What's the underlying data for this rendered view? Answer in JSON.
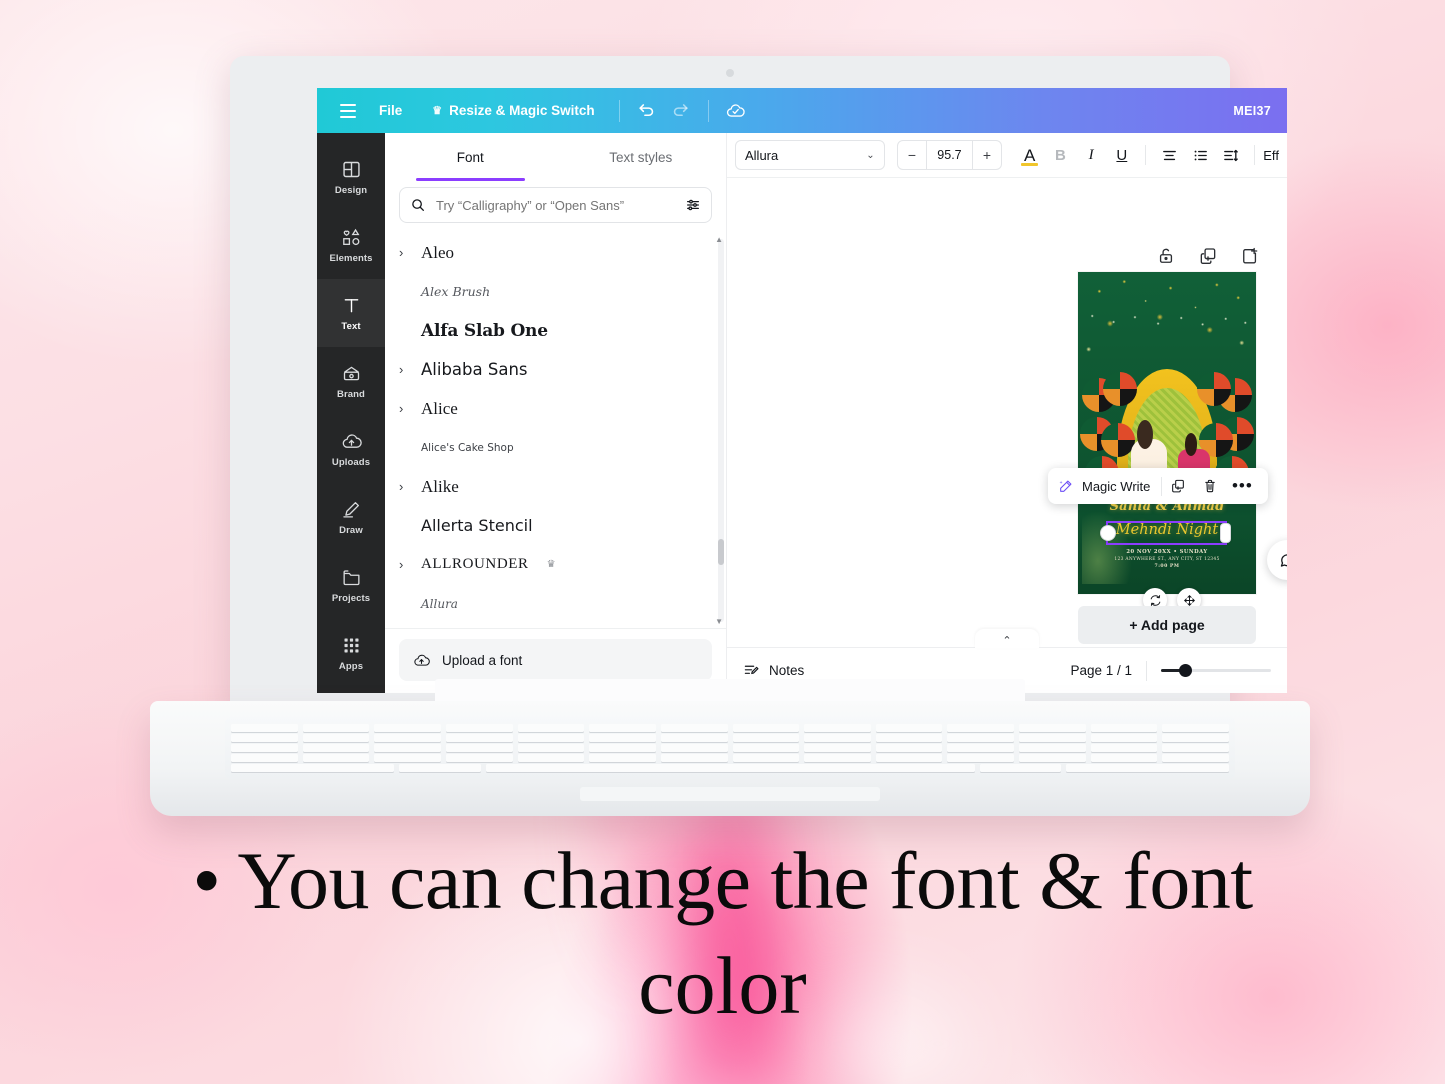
{
  "app": {
    "topbar": {
      "menu_icon": "hamburger-icon",
      "file_label": "File",
      "resize_label": "Resize & Magic Switch",
      "crown_glyph": "♛",
      "undo_icon": "undo-icon",
      "redo_icon": "redo-icon",
      "cloud_icon": "cloud-saved-icon",
      "user_badge": "MEI37",
      "gradient_from": "#20c9d6",
      "gradient_to": "#7b6ff0"
    },
    "sidebar": {
      "items": [
        {
          "label": "Design",
          "icon": "design-icon",
          "active": false
        },
        {
          "label": "Elements",
          "icon": "elements-icon",
          "active": false
        },
        {
          "label": "Text",
          "icon": "text-icon",
          "active": true
        },
        {
          "label": "Brand",
          "icon": "brand-icon",
          "active": false
        },
        {
          "label": "Uploads",
          "icon": "uploads-icon",
          "active": false
        },
        {
          "label": "Draw",
          "icon": "draw-icon",
          "active": false
        },
        {
          "label": "Projects",
          "icon": "projects-icon",
          "active": false
        },
        {
          "label": "Apps",
          "icon": "apps-icon",
          "active": false
        }
      ]
    },
    "panel": {
      "tabs": [
        {
          "label": "Font",
          "active": true
        },
        {
          "label": "Text styles",
          "active": false
        }
      ],
      "search": {
        "placeholder": "Try “Calligraphy” or “Open Sans”",
        "value": "",
        "icon": "search-icon",
        "filter_icon": "filter-icon"
      },
      "fonts": [
        {
          "name": "Aleo",
          "expandable": true,
          "pro": false,
          "style": "f-aleo"
        },
        {
          "name": "Alex Brush",
          "expandable": false,
          "pro": false,
          "style": "f-alexbrush"
        },
        {
          "name": "Alfa Slab One",
          "expandable": false,
          "pro": false,
          "style": "f-alfaslab"
        },
        {
          "name": "Alibaba Sans",
          "expandable": true,
          "pro": false,
          "style": "f-alibaba"
        },
        {
          "name": "Alice",
          "expandable": true,
          "pro": false,
          "style": "f-alice"
        },
        {
          "name": "Alice's Cake Shop",
          "expandable": false,
          "pro": false,
          "style": "f-cakeshop"
        },
        {
          "name": "Alike",
          "expandable": true,
          "pro": false,
          "style": "f-alike"
        },
        {
          "name": "Allerta Stencil",
          "expandable": false,
          "pro": false,
          "style": "f-allerta"
        },
        {
          "name": "ALLROUNDER",
          "expandable": true,
          "pro": true,
          "style": "f-allrounder"
        },
        {
          "name": "Allura",
          "expandable": false,
          "pro": false,
          "style": "f-allura"
        }
      ],
      "upload_label": "Upload a font",
      "upload_icon": "upload-cloud-icon",
      "crown_glyph": "♛",
      "scroll_up_glyph": "▲",
      "scroll_down_glyph": "▼"
    },
    "toolbar": {
      "font_family": "Allura",
      "font_size": "95.7",
      "minus_label": "−",
      "plus_label": "+",
      "text_color_icon": "text-color-icon",
      "text_color_swatch": "#f1c62c",
      "bold_label": "B",
      "italic_label": "I",
      "underline_label": "U",
      "align_icon": "align-center-icon",
      "list_icon": "bullet-list-icon",
      "spacing_icon": "line-spacing-icon",
      "effects_label": "Eff",
      "dropdown_glyph": "⌄"
    },
    "canvas": {
      "doc_icons": [
        {
          "name": "lock-icon"
        },
        {
          "name": "duplicate-page-icon"
        },
        {
          "name": "add-page-icon"
        }
      ],
      "design": {
        "title_line1": "Sania & Ahmad",
        "title_line2": "Mehndi Night",
        "date_line": "20 NOV 20XX • SUNDAY",
        "address_line": "123 ANYWHERE ST., ANY CITY, ST 12345",
        "time_line": "7:00 PM",
        "background_color": "#0f5b33",
        "accent_color": "#f3d24a",
        "selection_color": "#8b3dff"
      },
      "float_toolbar": {
        "magic_write_label": "Magic Write",
        "magic_write_icon": "magic-wand-icon",
        "duplicate_icon": "duplicate-icon",
        "delete_icon": "trash-icon",
        "more_label": "•••"
      },
      "rotate_icon": "rotate-icon",
      "move_icon": "move-icon",
      "comment_icon": "comment-icon",
      "add_page_label": "+ Add page"
    },
    "bottombar": {
      "notes_label": "Notes",
      "notes_icon": "notes-icon",
      "page_indicator": "Page 1 / 1",
      "collapse_glyph": "⌃",
      "zoom_icon": "zoom-slider"
    }
  },
  "caption": {
    "line1": "• You can change the font & font",
    "line2": "color"
  }
}
